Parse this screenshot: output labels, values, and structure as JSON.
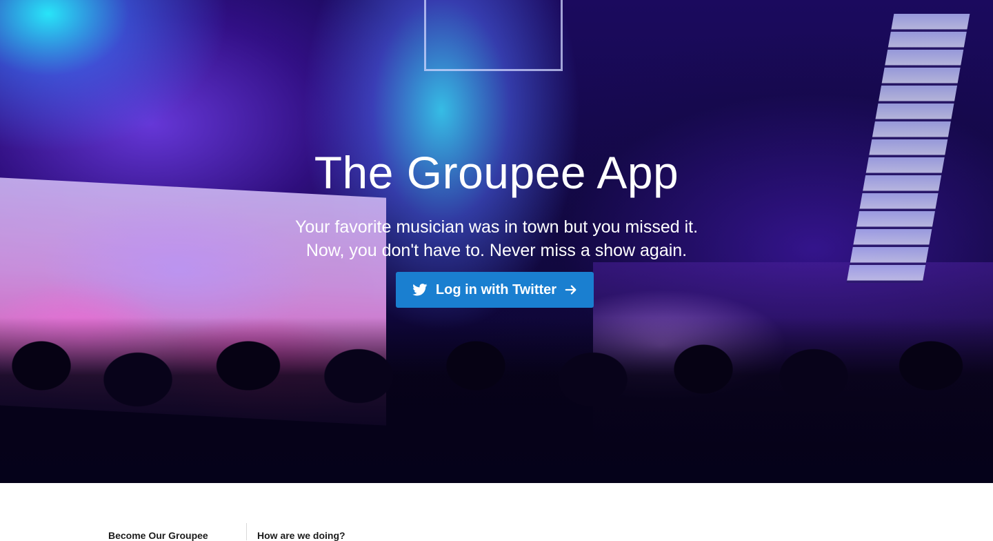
{
  "hero": {
    "title": "The Groupee App",
    "subtitle_line1": "Your favorite musician was in town but you missed it.",
    "subtitle_line2": "Now, you don't have to. Never miss a show again.",
    "login_button": {
      "label": "Log in with Twitter",
      "icon_left": "twitter-icon",
      "icon_right": "arrow-right-icon",
      "color": "#1a7fd0"
    }
  },
  "footer": {
    "links": [
      "Become Our Groupee",
      "How are we doing?"
    ]
  }
}
